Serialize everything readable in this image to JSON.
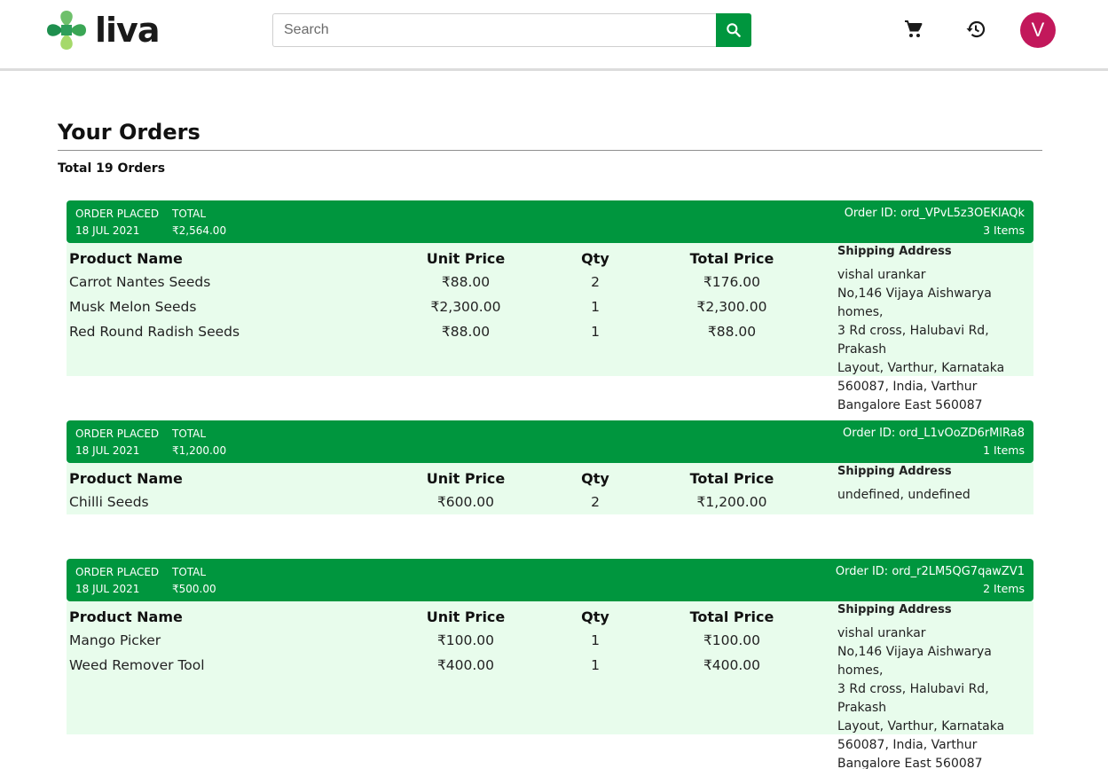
{
  "header": {
    "logo_text": "liva",
    "search_placeholder": "Search",
    "avatar_initial": "V",
    "brand_color": "#00963e",
    "avatar_color": "#c2185b"
  },
  "page": {
    "title": "Your Orders",
    "total_orders": "Total 19 Orders"
  },
  "labels": {
    "order_placed": "ORDER PLACED",
    "total": "TOTAL",
    "product_name": "Product Name",
    "unit_price": "Unit Price",
    "qty": "Qty",
    "total_price": "Total Price",
    "shipping_address": "Shipping Address"
  },
  "orders": [
    {
      "date": "18 JUL 2021",
      "total": "₹2,564.00",
      "order_id": "Order ID: ord_VPvL5z3OEKlAQk",
      "items_count": "3 Items",
      "items": [
        {
          "name": "Carrot Nantes Seeds",
          "unit": "₹88.00",
          "qty": "2",
          "total": "₹176.00"
        },
        {
          "name": "Musk Melon Seeds",
          "unit": "₹2,300.00",
          "qty": "1",
          "total": "₹2,300.00"
        },
        {
          "name": "Red Round Radish Seeds",
          "unit": "₹88.00",
          "qty": "1",
          "total": "₹88.00"
        }
      ],
      "address": [
        "vishal urankar",
        "No,146 Vijaya Aishwarya homes,",
        "3 Rd cross, Halubavi Rd, Prakash",
        "Layout, Varthur, Karnataka",
        "560087, India, Varthur",
        "Bangalore East 560087"
      ]
    },
    {
      "date": "18 JUL 2021",
      "total": "₹1,200.00",
      "order_id": "Order ID: ord_L1vOoZD6rMlRa8",
      "items_count": "1 Items",
      "items": [
        {
          "name": "Chilli Seeds",
          "unit": "₹600.00",
          "qty": "2",
          "total": "₹1,200.00"
        }
      ],
      "address": [
        "undefined, undefined"
      ]
    },
    {
      "date": "18 JUL 2021",
      "total": "₹500.00",
      "order_id": "Order ID: ord_r2LM5QG7qawZV1",
      "items_count": "2 Items",
      "items": [
        {
          "name": "Mango Picker",
          "unit": "₹100.00",
          "qty": "1",
          "total": "₹100.00"
        },
        {
          "name": "Weed Remover Tool",
          "unit": "₹400.00",
          "qty": "1",
          "total": "₹400.00"
        }
      ],
      "address": [
        "vishal urankar",
        "No,146 Vijaya Aishwarya homes,",
        "3 Rd cross, Halubavi Rd, Prakash",
        "Layout, Varthur, Karnataka",
        "560087, India, Varthur",
        "Bangalore East 560087"
      ]
    }
  ]
}
